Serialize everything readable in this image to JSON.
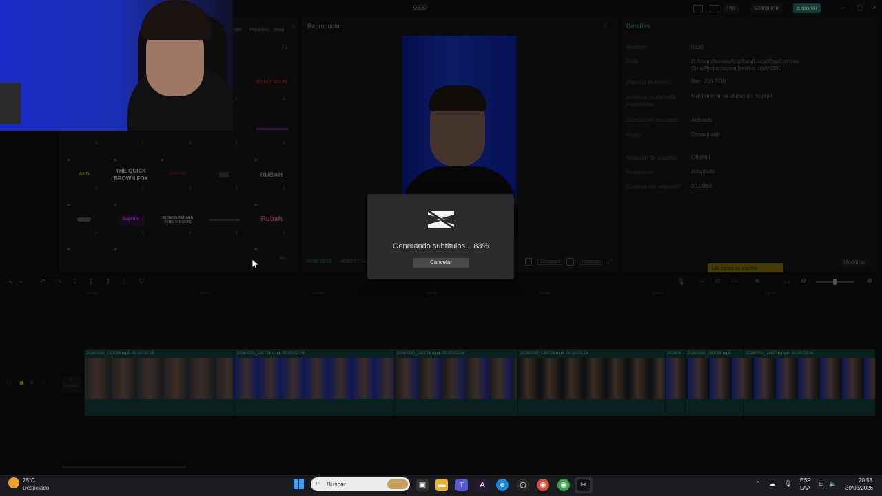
{
  "app": {
    "project_name": "0330",
    "pro_label": "Pro",
    "share_label": "Compartir",
    "export_label": "Exportar"
  },
  "media_panel": {
    "tabs": [
      "iste",
      "Plantillas",
      "Avalú"
    ],
    "sort_icon_label": "T↓",
    "tiles": [
      {
        "text": "VELOCE VOLPE",
        "color": "#b81e1e"
      },
      {
        "text": "ANG",
        "color": "#b8b31e"
      },
      {
        "text": "THE QUICK BROWN FOX",
        "color": "#d7d7d7"
      },
      {
        "text": "DURIAN",
        "color": "#8b1717"
      },
      {
        "text": "RUBAH",
        "color": "#8b8b8b"
      },
      {
        "text": "Saphiki",
        "color": "#c040ff"
      },
      {
        "text": "MUSANG PERANG YANG TANGKAS",
        "color": "#aaaaaa"
      },
      {
        "text": "Rubah",
        "color": "#e05070"
      }
    ],
    "pro_badge": "Pro"
  },
  "player": {
    "label": "Reproductor",
    "time_current": "00:02:16:23",
    "time_total": "00:02:17:11",
    "complete_label": "Completa",
    "ratio_label": "Relación"
  },
  "details": {
    "title": "Detalles",
    "rows": [
      {
        "label": "Nombre",
        "value": "0330"
      },
      {
        "label": "Ruta",
        "value": "C:/Users/tomas/AppData/Local/CapCut/User Data/Projects/com.lveditor.draft/0330"
      },
      {
        "label": "Espacio cromático",
        "value": "Rec. 709 SDR"
      },
      {
        "label": "Archivos multimedia importados",
        "value": "Mantener en la ubicación original"
      },
      {
        "label": "Disposición de capas",
        "value": "Activado"
      },
      {
        "label": "Proxy",
        "value": "Desactivado"
      },
      {
        "label": "Relación de aspecto",
        "value": "Original"
      },
      {
        "label": "Resolución",
        "value": "Adaptado"
      },
      {
        "label": "Cuadros por segundo",
        "value": "30.00fps"
      }
    ],
    "tooltip": "Las capas se pueden",
    "modify_label": "Modificar"
  },
  "modal": {
    "status_text": "Generando subtítulos... 83%",
    "progress_percent": 83,
    "cancel_label": "Cancelar"
  },
  "timeline": {
    "ticks": [
      "00:00",
      "00:02",
      "00:04",
      "00:06",
      "00:08",
      "00:10",
      "00:12"
    ],
    "cover_label": "Portada",
    "clips": [
      {
        "name": "20260330_190726.mp4",
        "duration": "00:00:02:19"
      },
      {
        "name": "20260330_190726.mp4",
        "duration": "00:00:02:28"
      },
      {
        "name": "20260330_190726.mp4",
        "duration": "00:00:02:05"
      },
      {
        "name": "20260330_190726.mp4",
        "duration": "00:00:02:18"
      },
      {
        "name": "202603",
        "duration": ""
      },
      {
        "name": "20260330_190726.mp4",
        "duration": ""
      },
      {
        "name": "20260330_190726.mp4",
        "duration": "00:00:03:04"
      }
    ]
  },
  "taskbar": {
    "weather_temp": "25°C",
    "weather_desc": "Despejado",
    "search_placeholder": "Buscar",
    "lang_top": "ESP",
    "lang_bottom": "LAA",
    "time": "20:58",
    "date": "30/03/2026"
  }
}
